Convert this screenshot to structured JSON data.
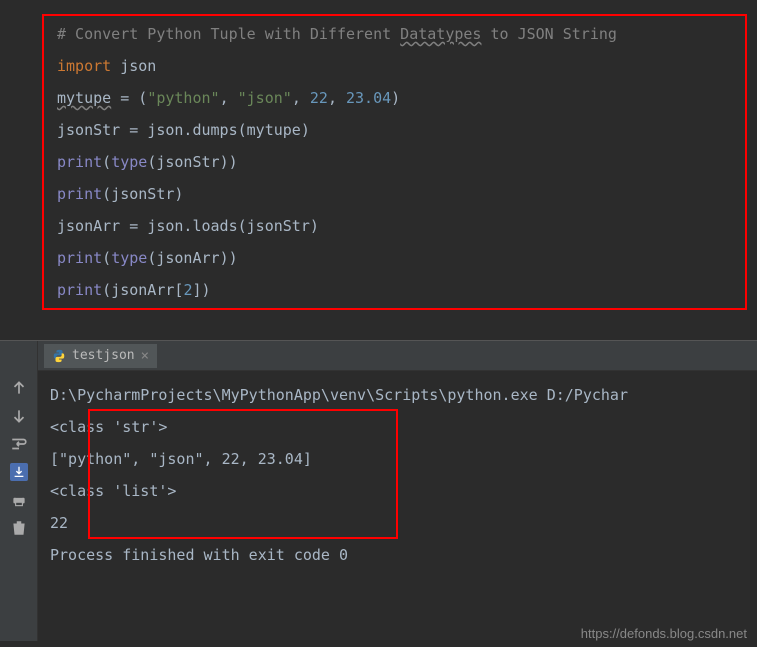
{
  "code": {
    "comment_prefix": "#",
    "comment_text": " Convert Python Tuple with Different ",
    "comment_underline": "Datatypes",
    "comment_suffix": " to JSON String",
    "import_kw": "import",
    "import_mod": "json",
    "var_mytupe": "mytupe",
    "assign": " = ",
    "paren_open": "(",
    "paren_close": ")",
    "str_python": "\"python\"",
    "str_json": "\"json\"",
    "comma": ", ",
    "num_22": "22",
    "num_2304": "23.04",
    "var_jsonStr": "jsonStr",
    "json_dumps": "json.dumps",
    "print_fn": "print",
    "type_fn": "type",
    "var_jsonArr": "jsonArr",
    "json_loads": "json.loads",
    "bracket_open": "[",
    "bracket_close": "]",
    "index_2": "2"
  },
  "tab": {
    "name": "testjson",
    "close": "×"
  },
  "output": {
    "line1": "D:\\PycharmProjects\\MyPythonApp\\venv\\Scripts\\python.exe D:/Pychar",
    "line2": "<class 'str'>",
    "line3": "[\"python\", \"json\", 22, 23.04]",
    "line4": "<class 'list'>",
    "line5": "22",
    "line6": "",
    "line7": "Process finished with exit code 0"
  },
  "watermark": "https://defonds.blog.csdn.net"
}
